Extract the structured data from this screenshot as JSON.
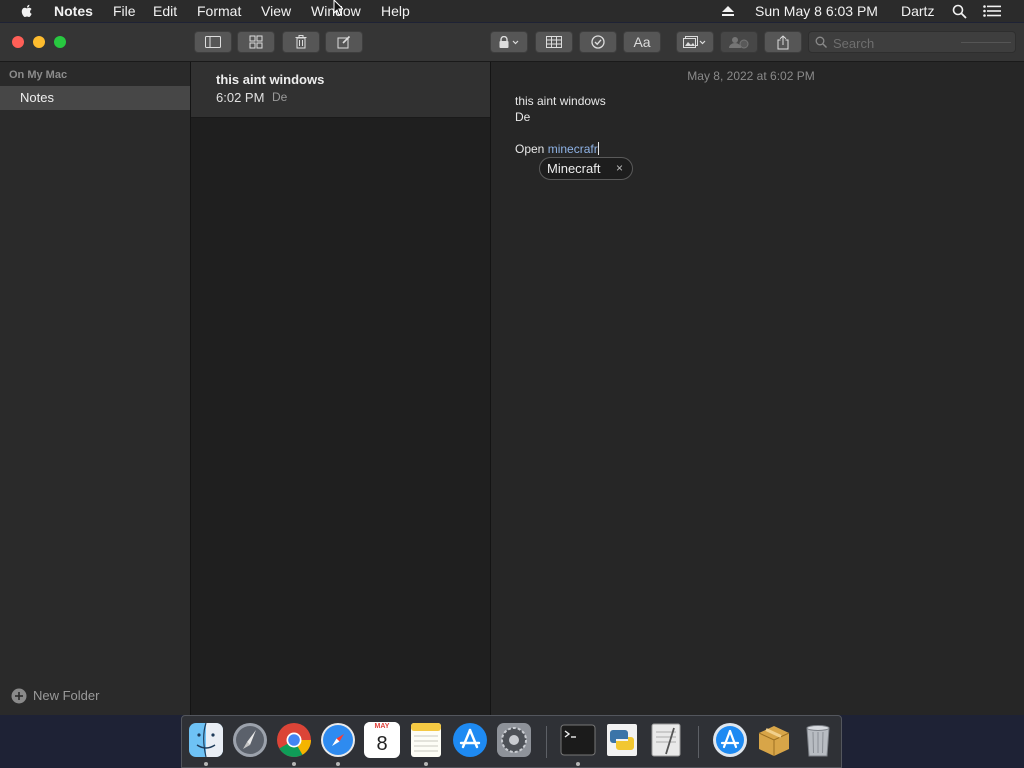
{
  "menubar": {
    "app_name": "Notes",
    "menus": [
      "File",
      "Edit",
      "Format",
      "View",
      "Window",
      "Help"
    ],
    "clock": "Sun May 8  6:03 PM",
    "user": "Dartz",
    "icons": [
      "apple-icon",
      "eject-icon",
      "spotlight-search-icon",
      "notification-center-icon"
    ]
  },
  "toolbar": {
    "search_placeholder": "Search",
    "buttons": [
      "sidebar-toggle",
      "gallery-view",
      "delete",
      "compose",
      "lock",
      "table",
      "checklist",
      "format-text",
      "attachments-gallery",
      "collaborate",
      "share"
    ],
    "format_label": "Aa"
  },
  "sidebar": {
    "section_title": "On My Mac",
    "folders": [
      {
        "label": "Notes",
        "selected": true
      }
    ],
    "new_folder_label": "New Folder"
  },
  "note_list": [
    {
      "title": "this aint windows",
      "time": "6:02 PM",
      "preview": "De",
      "selected": true
    }
  ],
  "editor": {
    "date": "May 8, 2022 at 6:02 PM",
    "lines": [
      "this aint windows",
      "De"
    ],
    "typing_prefix": "Open ",
    "typing_word": "minecrafr",
    "autocorrect_suggestion": "Minecraft",
    "autocorrect_dismiss": "×"
  },
  "dock": {
    "apps": [
      "Finder",
      "Launchpad",
      "Google Chrome",
      "Safari",
      "Calendar",
      "Notes",
      "App Store",
      "System Preferences",
      "Terminal",
      "Python Launcher",
      "Script Editor",
      "Downloads",
      "Archive Utility",
      "Trash"
    ],
    "calendar_month": "MAY",
    "calendar_day": "8"
  },
  "colors": {
    "accent_red": "#ff5f57",
    "accent_yellow": "#febc2e",
    "accent_green": "#28c840",
    "selection": "#474747"
  }
}
